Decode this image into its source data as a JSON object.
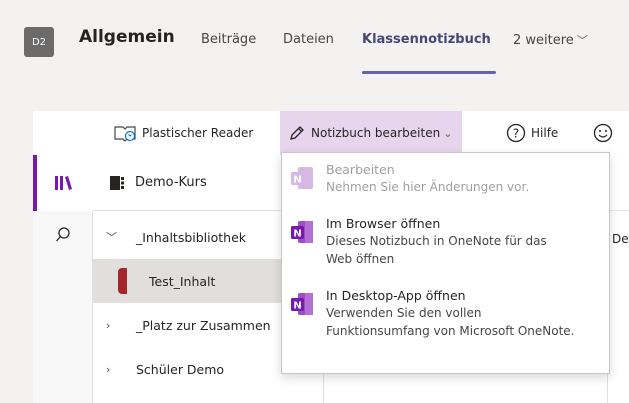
{
  "header": {
    "team_initials": "D2",
    "team_name": "Allgemein",
    "tabs": [
      {
        "label": "Beiträge"
      },
      {
        "label": "Dateien"
      },
      {
        "label": "Klassennotizbuch"
      },
      {
        "label": "2 weitere"
      }
    ]
  },
  "toolbar": {
    "reader_label": "Plastischer Reader",
    "edit_label": "Notizbuch bearbeiten",
    "help_label": "Hilfe"
  },
  "nav": {
    "notebook": "Demo-Kurs",
    "items": [
      {
        "label": "_Inhaltsbibliothek"
      },
      {
        "label": "Test_Inhalt"
      },
      {
        "label": "_Platz zur Zusammen"
      },
      {
        "label": "Schüler Demo"
      }
    ]
  },
  "page": {
    "right_text": "De"
  },
  "dropdown": {
    "items": [
      {
        "title": "Bearbeiten",
        "desc": "Nehmen Sie hier Änderungen vor."
      },
      {
        "title": "Im Browser öffnen",
        "desc": "Dieses Notizbuch in OneNote für das Web öffnen"
      },
      {
        "title": "In Desktop-App öffnen",
        "desc": "Verwenden Sie den vollen Funktionsumfang von Microsoft OneNote."
      }
    ]
  },
  "colors": {
    "accent": "#6264a7",
    "edit_highlight": "#e6d5ec",
    "onenote": "#7719aa",
    "section_marker": "#a4262c"
  }
}
